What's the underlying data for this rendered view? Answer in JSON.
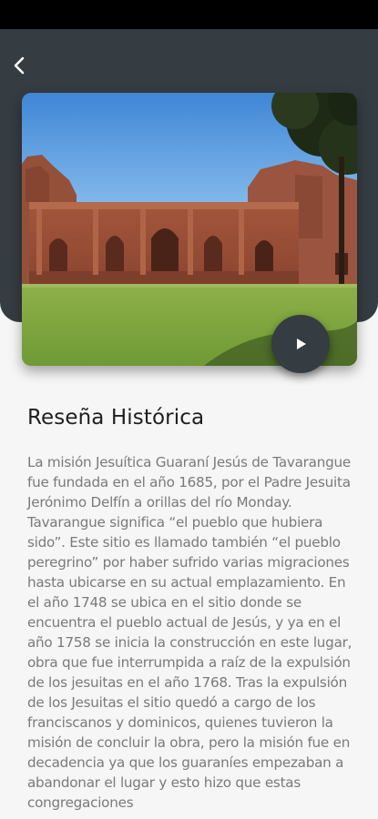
{
  "colors": {
    "header_background": "#353c42",
    "page_background": "#f6f6f6",
    "title_text": "#1f1f1f",
    "body_text": "#7a7a7a",
    "status_bar": "#000000"
  },
  "header": {
    "back_icon": "chevron-left-icon",
    "image_alt": "Misión Jesuítica Jesús de Tavarangue"
  },
  "media": {
    "play_icon": "play-icon"
  },
  "content": {
    "title": "Reseña Histórica",
    "body": "La misión Jesuítica Guaraní Jesús de Tavarangue fue fundada en el año 1685, por el Padre Jesuita Jerónimo Delfín a orillas del río Monday. Tavarangue significa “el pueblo que hubiera sido”. Este sitio es llamado también “el pueblo peregrino” por haber sufrido varias migraciones hasta ubicarse en su actual emplazamiento. En el año 1748 se ubica en el sitio donde se encuentra el pueblo actual de Jesús, y ya en el año 1758 se inicia la construcción en este lugar, obra que fue interrumpida a raíz de la expulsión de los jesuitas en el año 1768. Tras la expulsión de los Jesuitas el sitio quedó a cargo de los franciscanos y dominicos, quienes tuvieron la misión de concluir la obra, pero la misión fue en decadencia ya que los guaraníes empezaban a abandonar el lugar y esto hizo que estas congregaciones"
  }
}
